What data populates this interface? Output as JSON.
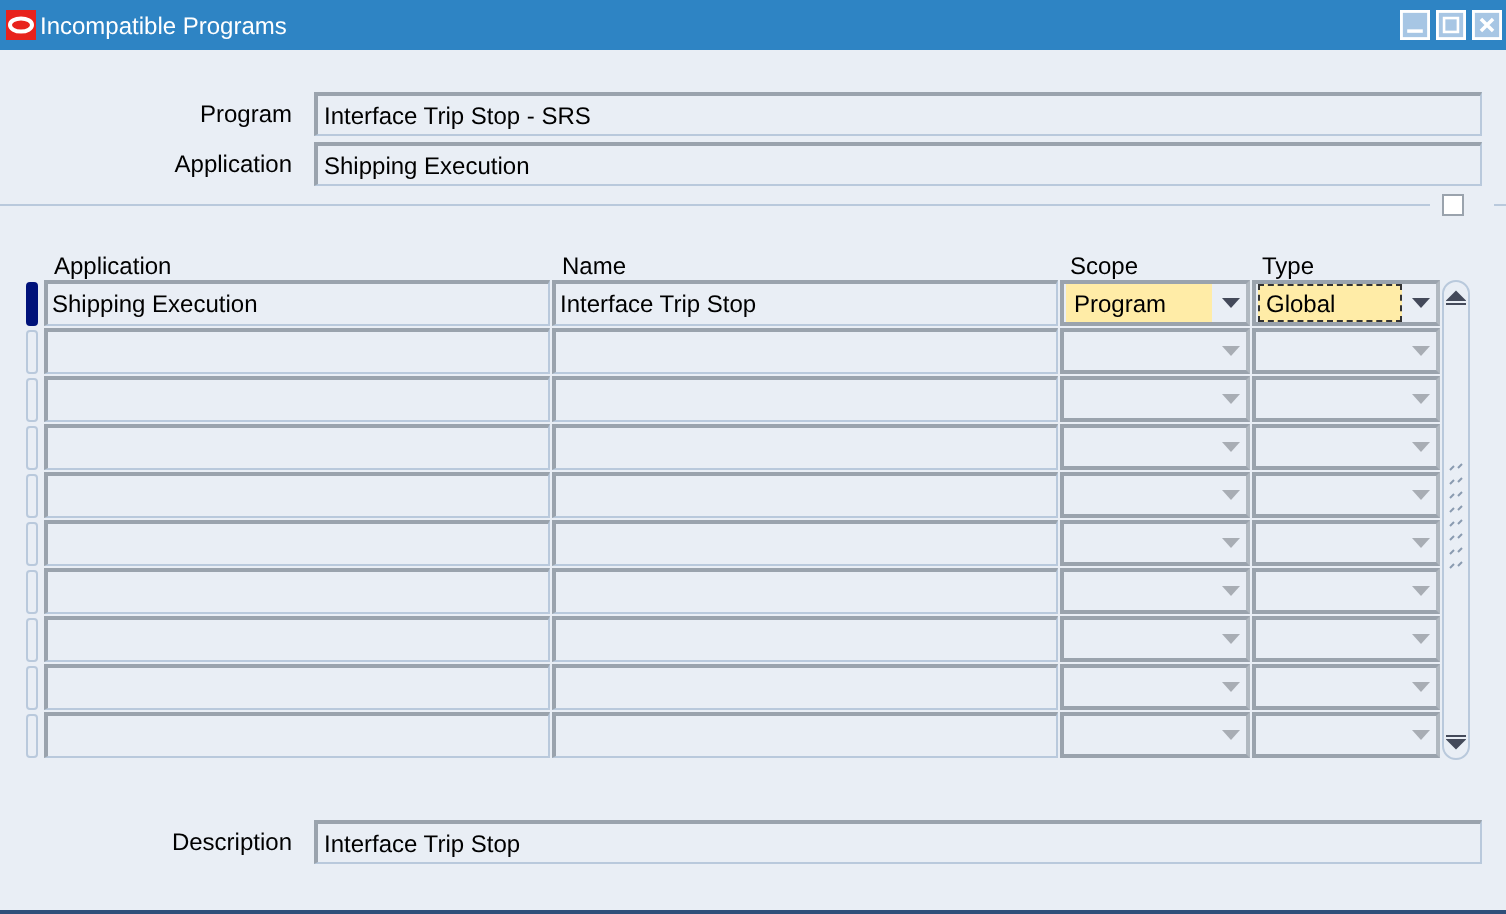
{
  "window": {
    "title": "Incompatible Programs"
  },
  "header": {
    "fields": [
      {
        "label": "Program",
        "value": "Interface Trip Stop - SRS"
      },
      {
        "label": "Application",
        "value": "Shipping Execution"
      }
    ],
    "checkbox": {
      "checked": false
    }
  },
  "table": {
    "columns": [
      "Application",
      "Name",
      "Scope",
      "Type"
    ],
    "rows": [
      {
        "selected": true,
        "highlighted": true,
        "type_focused": true,
        "application": "Shipping Execution",
        "name": "Interface Trip Stop",
        "scope": "Program",
        "type": "Global"
      },
      {
        "selected": false,
        "highlighted": false,
        "type_focused": false
      },
      {
        "selected": false,
        "highlighted": false,
        "type_focused": false
      },
      {
        "selected": false,
        "highlighted": false,
        "type_focused": false
      },
      {
        "selected": false,
        "highlighted": false,
        "type_focused": false
      },
      {
        "selected": false,
        "highlighted": false,
        "type_focused": false
      },
      {
        "selected": false,
        "highlighted": false,
        "type_focused": false
      },
      {
        "selected": false,
        "highlighted": false,
        "type_focused": false
      },
      {
        "selected": false,
        "highlighted": false,
        "type_focused": false
      },
      {
        "selected": false,
        "highlighted": false,
        "type_focused": false
      }
    ]
  },
  "description": {
    "label": "Description",
    "value": "Interface Trip Stop"
  }
}
